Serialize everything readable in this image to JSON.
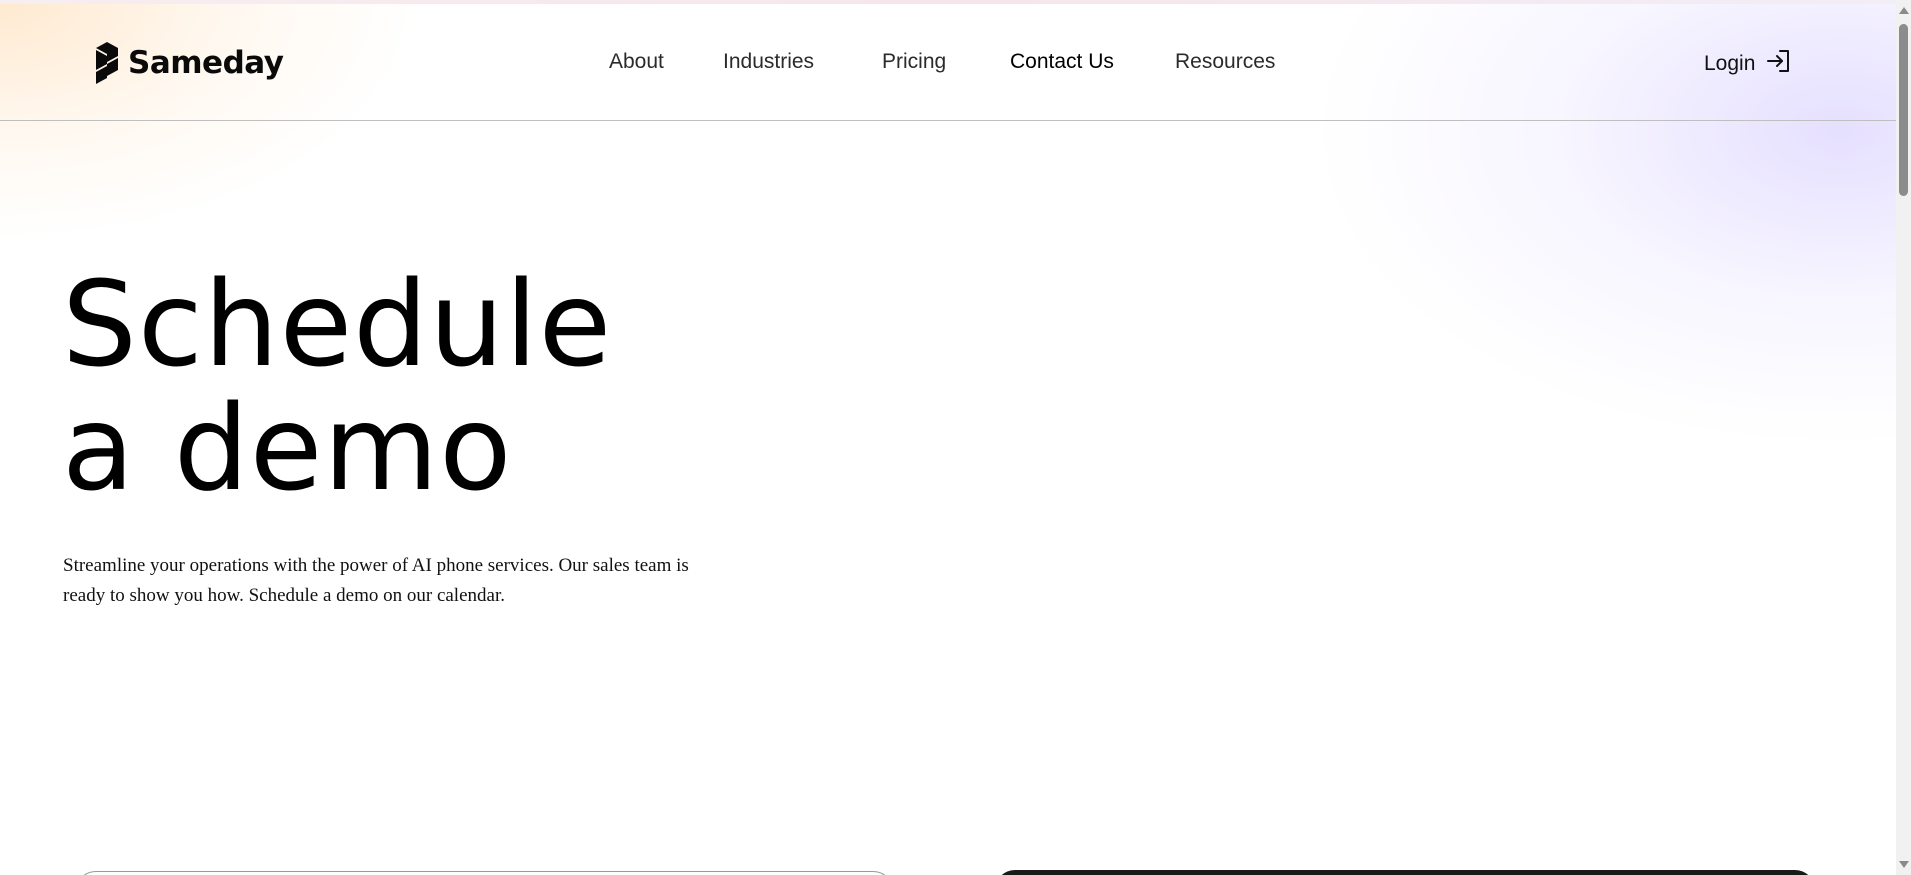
{
  "header": {
    "brand": "Sameday",
    "nav": [
      {
        "label": "About",
        "name": "nav-about"
      },
      {
        "label": "Industries",
        "name": "nav-industries"
      },
      {
        "label": "Pricing",
        "name": "nav-pricing"
      },
      {
        "label": "Contact Us",
        "name": "nav-contact-us"
      },
      {
        "label": "Resources",
        "name": "nav-resources"
      }
    ],
    "login_label": "Login"
  },
  "hero": {
    "title_line1": "Schedule",
    "title_line2": "a demo",
    "description": "Streamline your operations with the power of AI phone services. Our sales team is ready to show you how. Schedule a demo on our calendar."
  },
  "icons": {
    "logo": "sameday-logo-icon",
    "login": "login-arrow-icon"
  },
  "colors": {
    "text": "#000000",
    "nav_text": "#2b2b2b",
    "header_border": "#bfbfbf",
    "gradient_warm": "#ffe2c0",
    "gradient_cool": "#e1daff"
  }
}
